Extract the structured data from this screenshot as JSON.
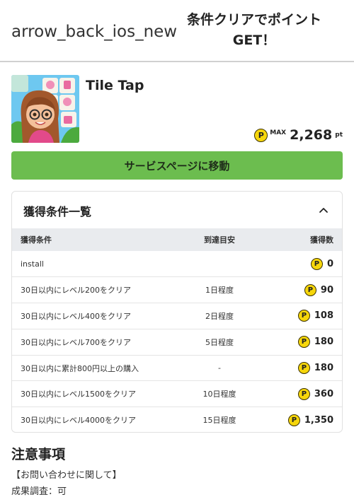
{
  "header": {
    "back_icon_text": "arrow_back_ios_new",
    "title": "条件クリアでポイントGET！"
  },
  "app": {
    "name": "Tile Tap",
    "max_label": "MAX",
    "max_points": "2,268",
    "points_unit": "pt",
    "coin_symbol": "P"
  },
  "service_button_label": "サービスページに移動",
  "conditions": {
    "title": "獲得条件一覧",
    "columns": [
      "獲得条件",
      "到達目安",
      "獲得数"
    ],
    "rows": [
      {
        "condition": "install",
        "estimate": "",
        "points": "0"
      },
      {
        "condition": "30日以内にレベル200をクリア",
        "estimate": "1日程度",
        "points": "90"
      },
      {
        "condition": "30日以内にレベル400をクリア",
        "estimate": "2日程度",
        "points": "108"
      },
      {
        "condition": "30日以内にレベル700をクリア",
        "estimate": "5日程度",
        "points": "180"
      },
      {
        "condition": "30日以内に累計800円以上の購入",
        "estimate": "-",
        "points": "180"
      },
      {
        "condition": "30日以内にレベル1500をクリア",
        "estimate": "10日程度",
        "points": "360"
      },
      {
        "condition": "30日以内にレベル4000をクリア",
        "estimate": "15日程度",
        "points": "1,350"
      }
    ]
  },
  "notes": {
    "heading": "注意事項",
    "line1": "【お問い合わせに関して】",
    "line2": "成果調査：可"
  },
  "colors": {
    "accent_green": "#6cbd4f",
    "coin_yellow": "#f6d60a",
    "table_header_bg": "#e9ebee"
  }
}
